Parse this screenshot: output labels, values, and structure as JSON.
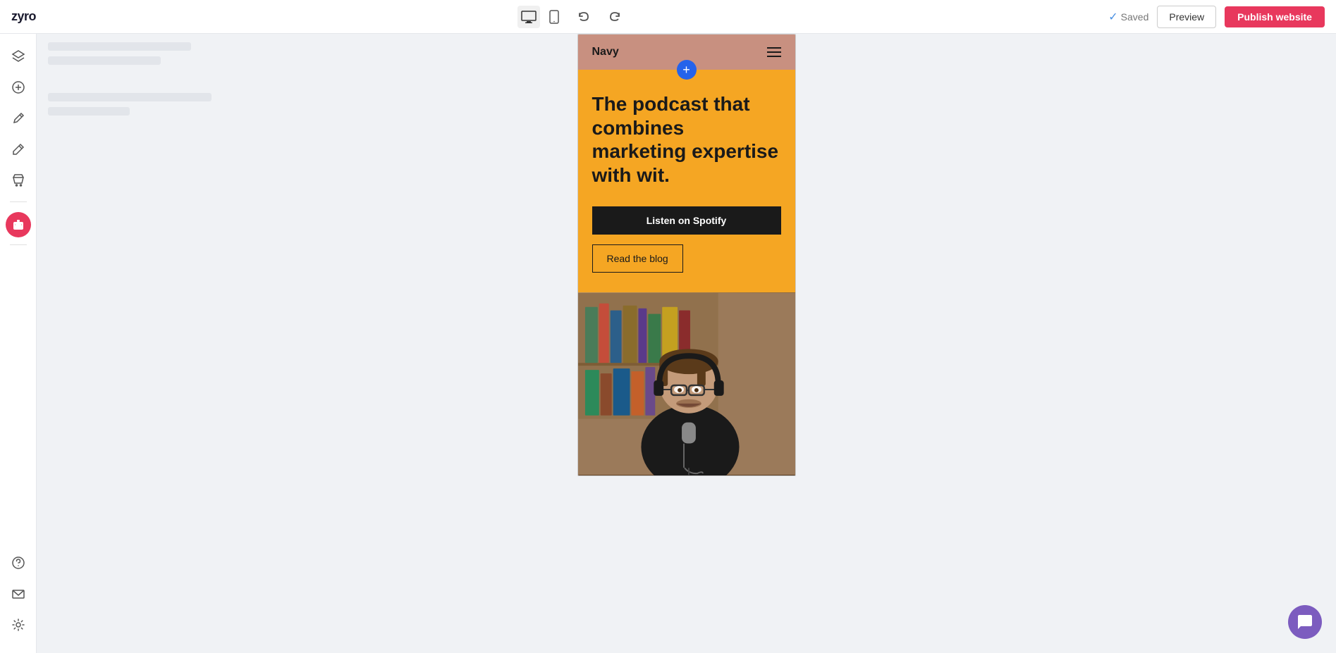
{
  "app": {
    "logo": "zyro"
  },
  "toolbar": {
    "saved_label": "Saved",
    "preview_label": "Preview",
    "publish_label": "Publish website",
    "undo_title": "Undo",
    "redo_title": "Redo"
  },
  "sidebar": {
    "icons": [
      {
        "name": "layers-icon",
        "symbol": "⊞"
      },
      {
        "name": "add-element-icon",
        "symbol": "⊕"
      },
      {
        "name": "pen-icon",
        "symbol": "✏"
      },
      {
        "name": "edit-icon",
        "symbol": "✒"
      },
      {
        "name": "shop-icon",
        "symbol": "🛒"
      },
      {
        "name": "help-icon",
        "symbol": "?"
      },
      {
        "name": "mail-icon",
        "symbol": "✉"
      },
      {
        "name": "settings-icon",
        "symbol": "⚙"
      }
    ]
  },
  "site": {
    "nav": {
      "title": "Navy",
      "menu_aria": "Menu"
    },
    "hero": {
      "headline": "The podcast that combines marketing expertise with wit.",
      "cta_primary": "Listen on Spotify",
      "cta_secondary": "Read the blog"
    },
    "add_section_label": "+"
  }
}
